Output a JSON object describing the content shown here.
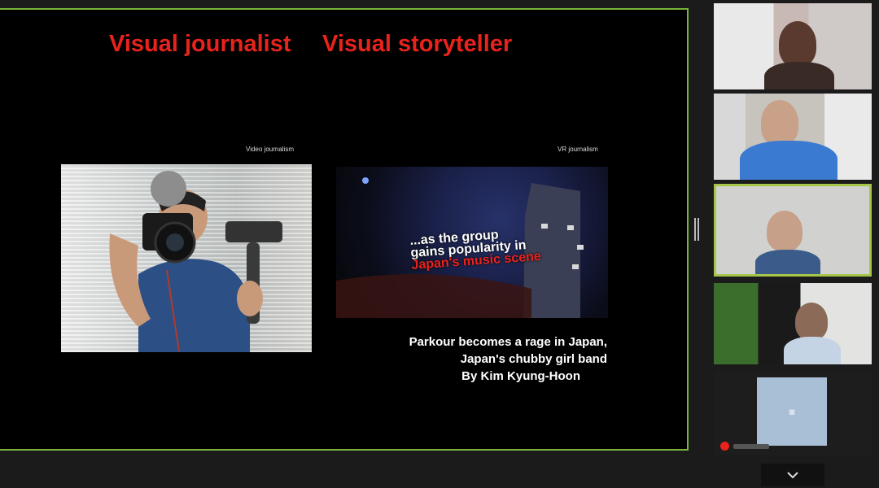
{
  "slide": {
    "title_left": "Visual journalist",
    "title_right": "Visual storyteller",
    "caption_left": "Video journalism",
    "caption_right": "VR journalism",
    "video_overlay": {
      "line1": "...as the group",
      "line2": "gains popularity in",
      "line3": "Japan's music scene"
    },
    "story_lines": [
      "Parkour becomes a rage in Japan,",
      "Japan's chubby girl band",
      "By Kim Kyung-Hoon"
    ]
  },
  "gallery": {
    "tiles": [
      "participant",
      "participant",
      "active-speaker",
      "participant",
      "avatar"
    ],
    "active_border_color": "#a6c64a",
    "share_border_color": "#7ab43a"
  },
  "icons": {
    "panel_divider": "drag-handle-icon",
    "scroll": "chevron-down-icon",
    "muted": "mic-muted-icon"
  },
  "colors": {
    "title_red": "#e8231c",
    "background": "#1b1b1b"
  }
}
